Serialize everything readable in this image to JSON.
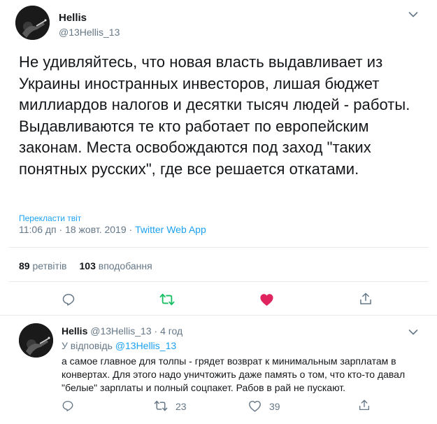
{
  "main_tweet": {
    "name": "Hellis",
    "handle": "@13Hellis_13",
    "text": "Не удивляйтесь, что новая власть выдавливает из Украины иностранных инвесторов, лишая бюджет миллиардов налогов и десятки тысяч людей - работы. Выдавливаются те кто работает по европейским законам. Места освобождаются под заход \"таких понятных русских\", где все решается откатами.",
    "translate_label": "Перекласти твіт",
    "time": "11:06 дп",
    "date": "18 жовт. 2019",
    "source": "Twitter Web App",
    "sep": "·",
    "retweets_count": "89",
    "retweets_label": "ретвітів",
    "likes_count": "103",
    "likes_label": "вподобання"
  },
  "reply_tweet": {
    "name": "Hellis",
    "handle": "@13Hellis_13",
    "sep": "·",
    "time_ago": "4 год",
    "reply_to_label": "У відповідь",
    "reply_to_handle": "@13Hellis_13",
    "text": "а самое главное для толпы - грядет возврат к минимальным зарплатам в конвертах. Для этого надо уничтожить даже память о том, что кто-то давал \"белые\" зарплаты и полный соцпакет. Рабов в рай не пускают.",
    "retweet_count": "23",
    "like_count": "39"
  },
  "colors": {
    "accent": "#1da1f2",
    "retweet": "#17bf63",
    "like": "#e0245e",
    "muted": "#657786",
    "text": "#14171a"
  },
  "icons": {
    "reply": "reply-icon",
    "retweet": "retweet-icon",
    "like": "heart-icon",
    "share": "share-icon",
    "more": "chevron-down-icon"
  }
}
